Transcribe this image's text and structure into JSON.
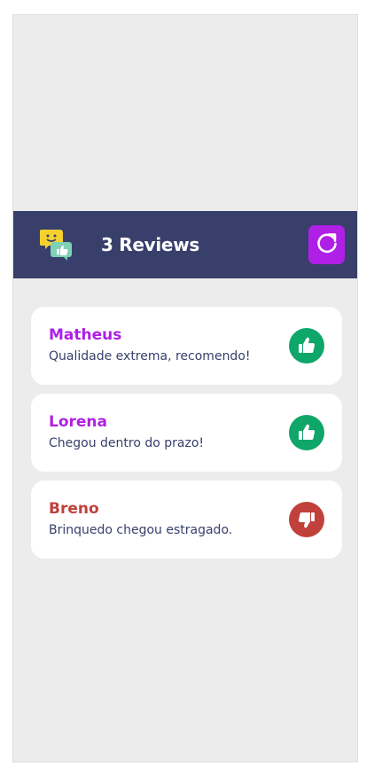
{
  "header": {
    "title": "3 Reviews",
    "logo_icon": "chat-bubbles-icon",
    "refresh_icon": "refresh-icon",
    "refresh_color": "#b01fe6",
    "background_color": "#383f6b"
  },
  "reviews": [
    {
      "name": "Matheus",
      "text": "Qualidade extrema, recomendo!",
      "sentiment": "positive",
      "name_color": "#b01fe6",
      "icon": "thumbs-up-icon",
      "icon_color": "#0fa66a"
    },
    {
      "name": "Lorena",
      "text": "Chegou dentro do prazo!",
      "sentiment": "positive",
      "name_color": "#b01fe6",
      "icon": "thumbs-up-icon",
      "icon_color": "#0fa66a"
    },
    {
      "name": "Breno",
      "text": "Brinquedo chegou estragado.",
      "sentiment": "negative",
      "name_color": "#c1403b",
      "icon": "thumbs-down-icon",
      "icon_color": "#c1403b"
    }
  ]
}
